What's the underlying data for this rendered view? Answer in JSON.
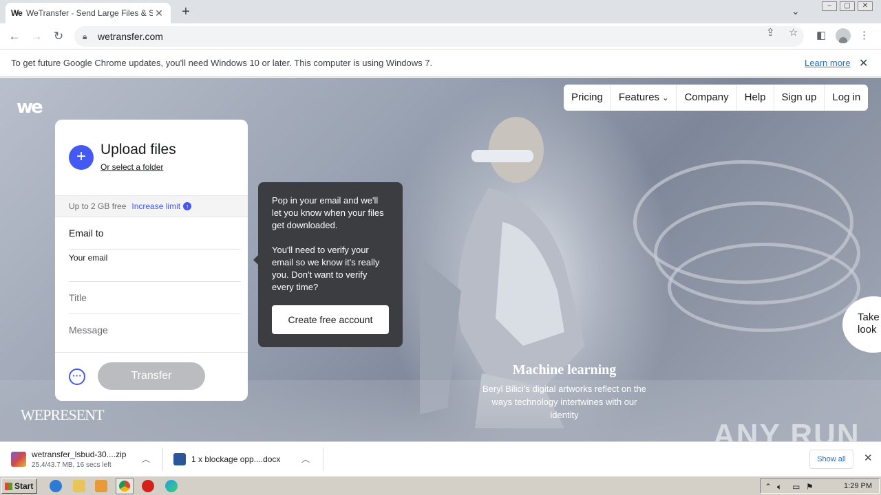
{
  "browser": {
    "tab_title": "WeTransfer - Send Large Files & Sha",
    "tab_favicon": "We",
    "url": "wetransfer.com"
  },
  "infobar": {
    "message": "To get future Google Chrome updates, you'll need Windows 10 or later. This computer is using Windows 7.",
    "learn_more": "Learn more"
  },
  "site": {
    "logo": "we",
    "nav": [
      "Pricing",
      "Features",
      "Company",
      "Help",
      "Sign up",
      "Log in"
    ],
    "upload": {
      "title": "Upload files",
      "select_folder": "Or select a folder",
      "limit_text": "Up to 2 GB free",
      "increase_limit": "Increase limit",
      "email_to": "Email to",
      "your_email": "Your email",
      "title_field": "Title",
      "message_field": "Message",
      "transfer_button": "Transfer"
    },
    "tooltip": {
      "para1": "Pop in your email and we'll let you know when your files get downloaded.",
      "para2": "You'll need to verify your email so we know it's really you. Don't want to verify every time?",
      "cta": "Create free account"
    },
    "wepresent": "WEPRESENT",
    "feature": {
      "heading": "Machine learning",
      "text": "Beryl Bilici's digital artworks reflect on the ways technology intertwines with our identity"
    },
    "take_look": "Take a look",
    "watermark": "ANY RUN"
  },
  "downloads": [
    {
      "name": "wetransfer_lsbud-30....zip",
      "status": "25.4/43.7 MB, 16 secs left"
    },
    {
      "name": "1 x blockage opp....docx",
      "status": ""
    }
  ],
  "shelf": {
    "show_all": "Show all"
  },
  "taskbar": {
    "start": "Start",
    "clock": "1:29 PM"
  }
}
